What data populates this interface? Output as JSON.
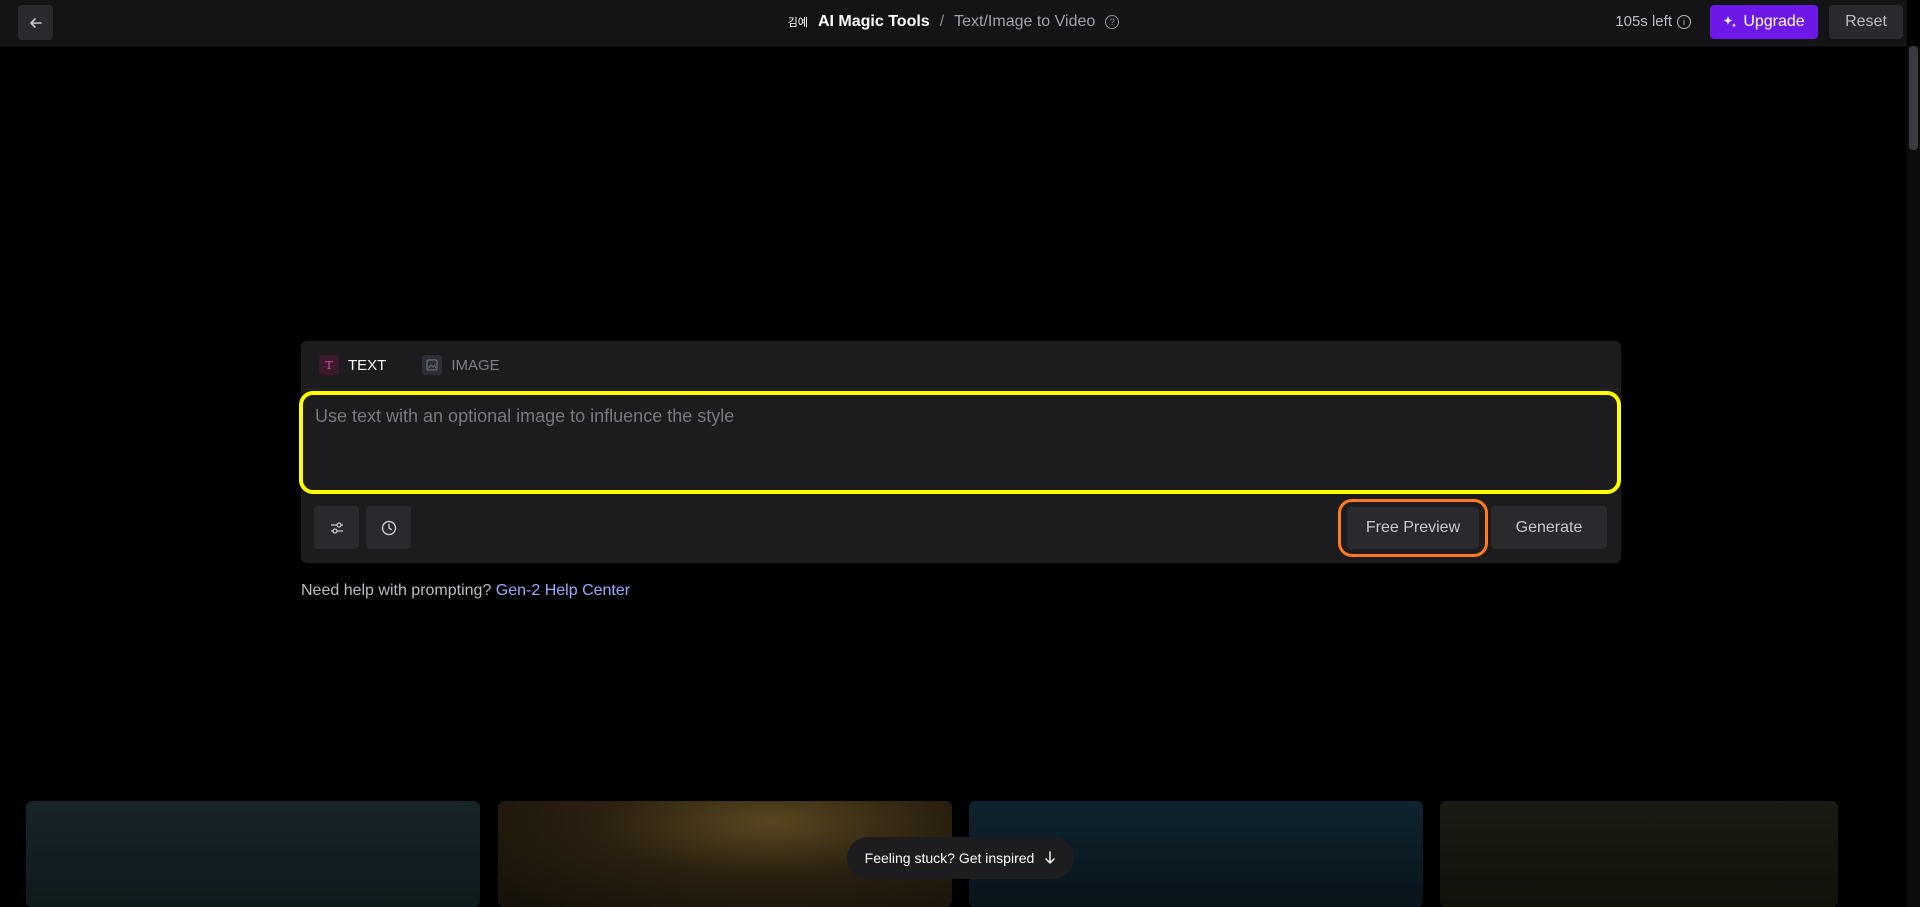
{
  "header": {
    "breadcrumb_prefix": "김예",
    "breadcrumb_main": "AI Magic Tools",
    "breadcrumb_separator": "/",
    "breadcrumb_current": "Text/Image to Video",
    "credits": "105s left",
    "upgrade_label": "Upgrade",
    "reset_label": "Reset"
  },
  "panel": {
    "tabs": [
      {
        "label": "TEXT",
        "icon": "text-icon",
        "active": true
      },
      {
        "label": "IMAGE",
        "icon": "image-icon",
        "active": false
      }
    ],
    "prompt_placeholder": "Use text with an optional image to influence the style",
    "prompt_value": "",
    "free_preview_label": "Free Preview",
    "generate_label": "Generate"
  },
  "help": {
    "question": "Need help with prompting?",
    "link_label": "Gen-2 Help Center"
  },
  "inspire": {
    "label": "Feeling stuck? Get inspired"
  },
  "colors": {
    "upgrade_bg": "#6b18e9",
    "prompt_highlight": "#ffff00",
    "preview_highlight": "#ff7a1f",
    "link": "#9ba8ff"
  }
}
